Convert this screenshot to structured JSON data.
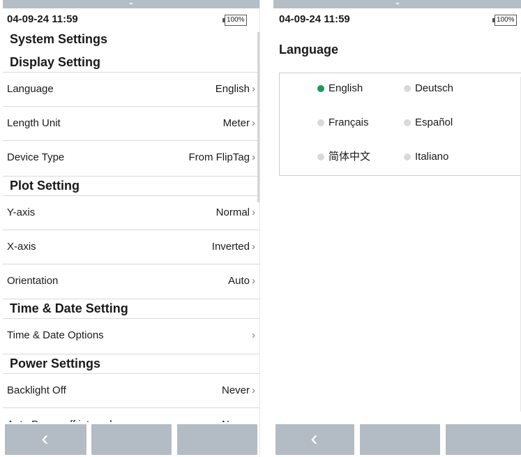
{
  "left": {
    "status": {
      "time": "04-09-24 11:59",
      "battery": "100%"
    },
    "title": "System Settings",
    "sections": [
      {
        "title": "Display Setting",
        "rows": [
          {
            "label": "Language",
            "value": "English"
          },
          {
            "label": "Length Unit",
            "value": "Meter"
          },
          {
            "label": "Device Type",
            "value": "From FlipTag"
          }
        ]
      },
      {
        "title": "Plot Setting",
        "rows": [
          {
            "label": "Y-axis",
            "value": "Normal"
          },
          {
            "label": "X-axis",
            "value": "Inverted"
          },
          {
            "label": "Orientation",
            "value": "Auto"
          }
        ]
      },
      {
        "title": "Time & Date Setting",
        "rows": [
          {
            "label": "Time & Date Options",
            "value": ""
          }
        ]
      },
      {
        "title": "Power Settings",
        "rows": [
          {
            "label": "Backlight Off",
            "value": "Never"
          },
          {
            "label": "Auto Power off interval",
            "value": "Never"
          }
        ]
      }
    ],
    "chevron": "›",
    "bottom": {
      "back": "‹"
    }
  },
  "right": {
    "status": {
      "time": "04-09-24 11:59",
      "battery": "100%"
    },
    "title": "Language",
    "options": [
      {
        "label": "English",
        "selected": true
      },
      {
        "label": "Deutsch",
        "selected": false
      },
      {
        "label": "Français",
        "selected": false
      },
      {
        "label": "Español",
        "selected": false
      },
      {
        "label": "简体中文",
        "selected": false
      },
      {
        "label": "Italiano",
        "selected": false
      }
    ],
    "selected_color": "#1a9a53",
    "bottom": {
      "back": "‹"
    }
  }
}
